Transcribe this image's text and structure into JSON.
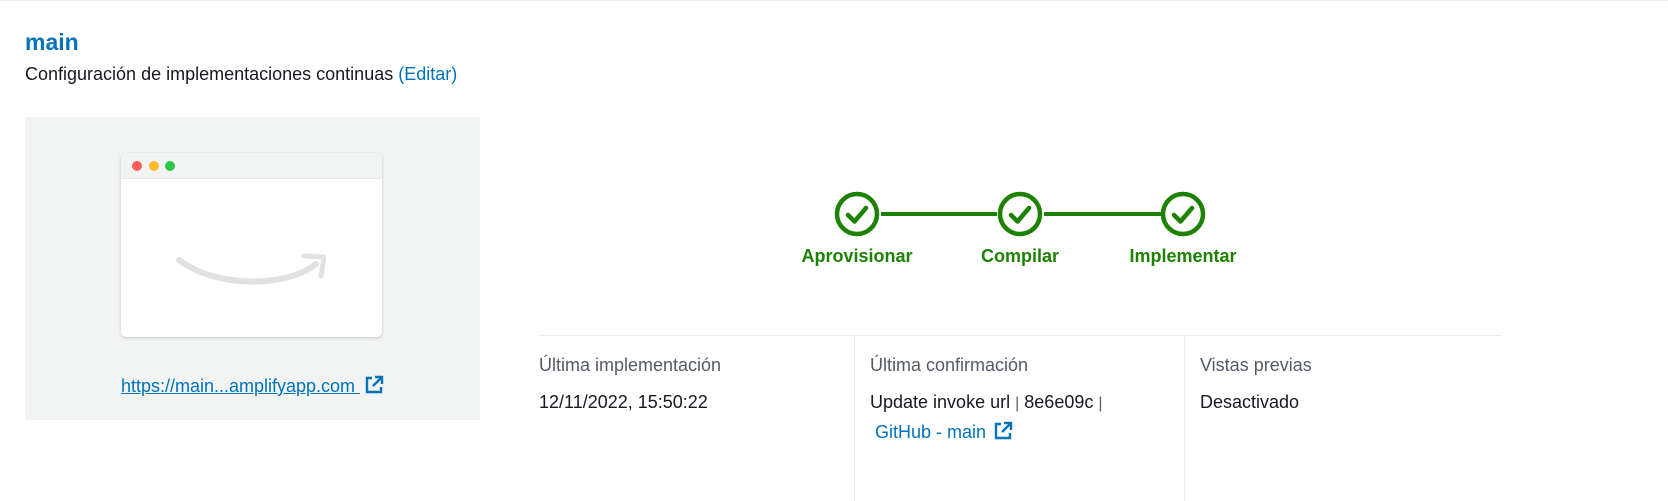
{
  "branch": {
    "title": "main",
    "subtitle_text": "Configuración de implementaciones continuas",
    "edit_link": "(Editar)"
  },
  "preview": {
    "url_label": "https://main...amplifyapp.com ",
    "icons": [
      "browser-window-icon",
      "amazon-smile-logo",
      "external-link-icon"
    ]
  },
  "pipeline": {
    "steps": [
      {
        "label": "Aprovisionar",
        "status": "success",
        "icon": "check-circle-icon"
      },
      {
        "label": "Compilar",
        "status": "success",
        "icon": "check-circle-icon"
      },
      {
        "label": "Implementar",
        "status": "success",
        "icon": "check-circle-icon"
      }
    ],
    "color": "#1d8102"
  },
  "details": {
    "last_deploy_key": "Última implementación",
    "last_deploy_value": "12/11/2022, 15:50:22",
    "last_commit_key": "Última confirmación",
    "commit_message": "Update invoke url",
    "commit_sep1": "|",
    "commit_hash": "8e6e09c",
    "commit_sep2": "|",
    "commit_repo_link": "GitHub - main",
    "previews_key": "Vistas previas",
    "previews_value": "Desactivado"
  },
  "colors": {
    "link": "#0073bb",
    "success": "#1d8102",
    "panel_bg": "#f2f3f3"
  }
}
